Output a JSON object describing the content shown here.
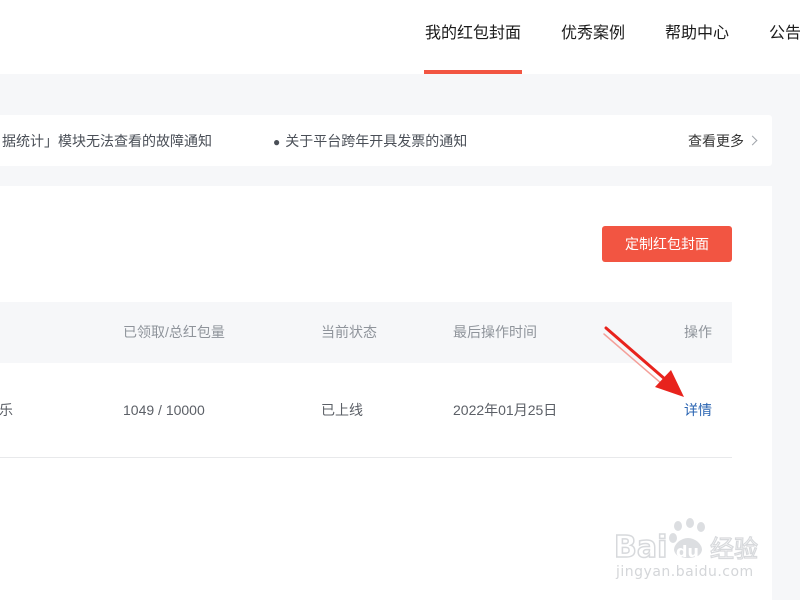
{
  "nav": {
    "items": [
      {
        "label": "我的红包封面",
        "active": true
      },
      {
        "label": "优秀案例",
        "active": false
      },
      {
        "label": "帮助中心",
        "active": false
      },
      {
        "label": "公告",
        "active": false
      }
    ]
  },
  "notices": {
    "items": [
      {
        "text": "据统计」模块无法查看的故障通知"
      },
      {
        "text": "关于平台跨年开具发票的通知"
      }
    ],
    "view_more": "查看更多"
  },
  "toolbar": {
    "create_label": "定制红包封面"
  },
  "table": {
    "columns": {
      "claimed": "已领取/总红包量",
      "status": "当前状态",
      "last_time": "最后操作时间",
      "action": "操作"
    },
    "rows": [
      {
        "name": "乐",
        "claimed": "1049 / 10000",
        "status": "已上线",
        "last_time": "2022年01月25日",
        "action": "详情"
      }
    ]
  },
  "colors": {
    "accent": "#f25542",
    "link": "#2a64b2",
    "annotation_arrow": "#e8231d"
  },
  "watermark": {
    "logo": "Bai du 经验",
    "site": "jingyan.baidu.com"
  }
}
